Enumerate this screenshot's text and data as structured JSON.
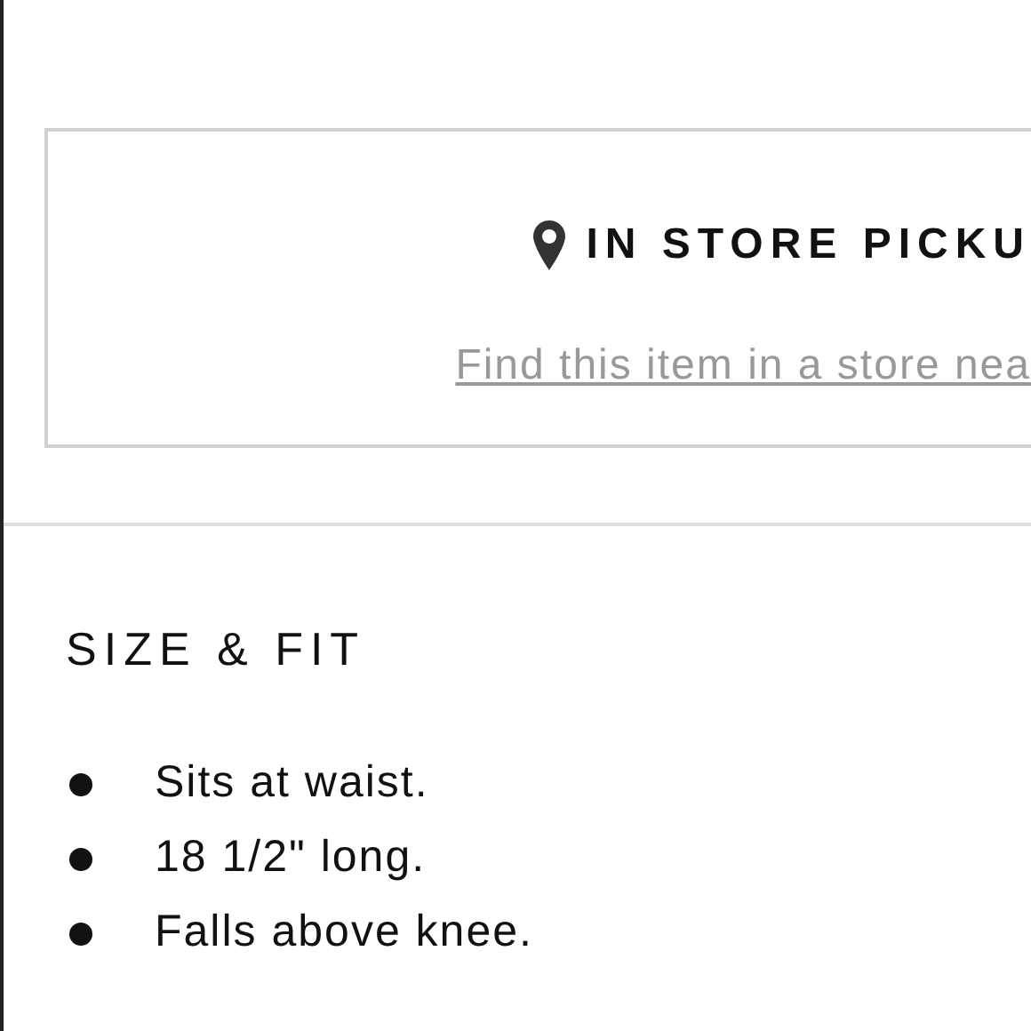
{
  "pickup": {
    "title": "IN STORE PICKU",
    "link": "Find this item in a store nea"
  },
  "size_fit": {
    "heading": "SIZE & FIT",
    "items": [
      "Sits at waist.",
      "18 1/2\" long.",
      "Falls above knee."
    ]
  }
}
